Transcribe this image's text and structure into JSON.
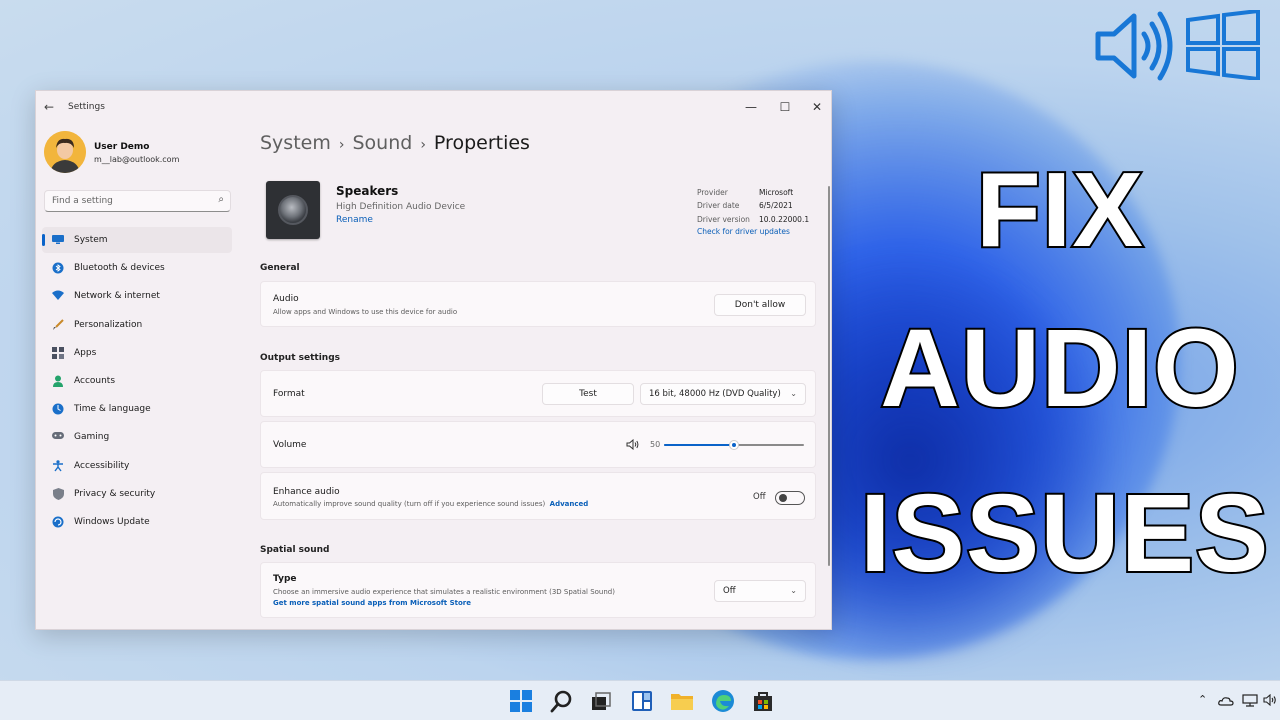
{
  "overlay": {
    "line1": "FIX",
    "line2": "AUDIO",
    "line3": "ISSUES"
  },
  "window": {
    "title": "Settings",
    "controls": {
      "minimize": "—",
      "maximize": "☐",
      "close": "✕"
    }
  },
  "user": {
    "name": "User Demo",
    "email": "m__lab@outlook.com"
  },
  "search": {
    "placeholder": "Find a setting"
  },
  "sidebar": {
    "items": [
      {
        "label": "System",
        "icon": "system-icon",
        "active": true
      },
      {
        "label": "Bluetooth & devices",
        "icon": "bluetooth-icon"
      },
      {
        "label": "Network & internet",
        "icon": "network-icon"
      },
      {
        "label": "Personalization",
        "icon": "personalization-icon"
      },
      {
        "label": "Apps",
        "icon": "apps-icon"
      },
      {
        "label": "Accounts",
        "icon": "accounts-icon"
      },
      {
        "label": "Time & language",
        "icon": "time-language-icon"
      },
      {
        "label": "Gaming",
        "icon": "gaming-icon"
      },
      {
        "label": "Accessibility",
        "icon": "accessibility-icon"
      },
      {
        "label": "Privacy & security",
        "icon": "privacy-icon"
      },
      {
        "label": "Windows Update",
        "icon": "windows-update-icon"
      }
    ]
  },
  "breadcrumb": {
    "items": [
      "System",
      "Sound",
      "Properties"
    ],
    "separator": "›"
  },
  "device": {
    "name": "Speakers",
    "subtitle": "High Definition Audio Device",
    "rename": "Rename",
    "driver": {
      "provider_label": "Provider",
      "provider": "Microsoft",
      "date_label": "Driver date",
      "date": "6/5/2021",
      "version_label": "Driver version",
      "version": "10.0.22000.1",
      "update_link": "Check for driver updates"
    }
  },
  "general": {
    "title": "General",
    "audio": {
      "title": "Audio",
      "desc": "Allow apps and Windows to use this device for audio",
      "button": "Don't allow"
    }
  },
  "output": {
    "title": "Output settings",
    "format": {
      "title": "Format",
      "test_button": "Test",
      "value": "16 bit, 48000 Hz (DVD Quality)"
    },
    "volume": {
      "title": "Volume",
      "value": "50",
      "level": 0.5
    },
    "enhance": {
      "title": "Enhance audio",
      "desc": "Automatically improve sound quality (turn off if you experience sound issues)",
      "link": "Advanced",
      "state": "Off"
    }
  },
  "spatial": {
    "title": "Spatial sound",
    "type": {
      "title": "Type",
      "desc": "Choose an immersive audio experience that simulates a realistic environment (3D Spatial Sound)",
      "link": "Get more spatial sound apps from Microsoft Store",
      "value": "Off"
    }
  },
  "colors": {
    "accent": "#0a63c9",
    "link": "#0a5fb8"
  },
  "taskbar": {
    "icons": [
      "start-icon",
      "search-icon",
      "task-view-icon",
      "widgets-icon",
      "file-explorer-icon",
      "edge-icon",
      "store-icon"
    ],
    "tray": [
      "chevron-up-icon",
      "onedrive-icon",
      "network-icon",
      "volume-icon"
    ]
  }
}
